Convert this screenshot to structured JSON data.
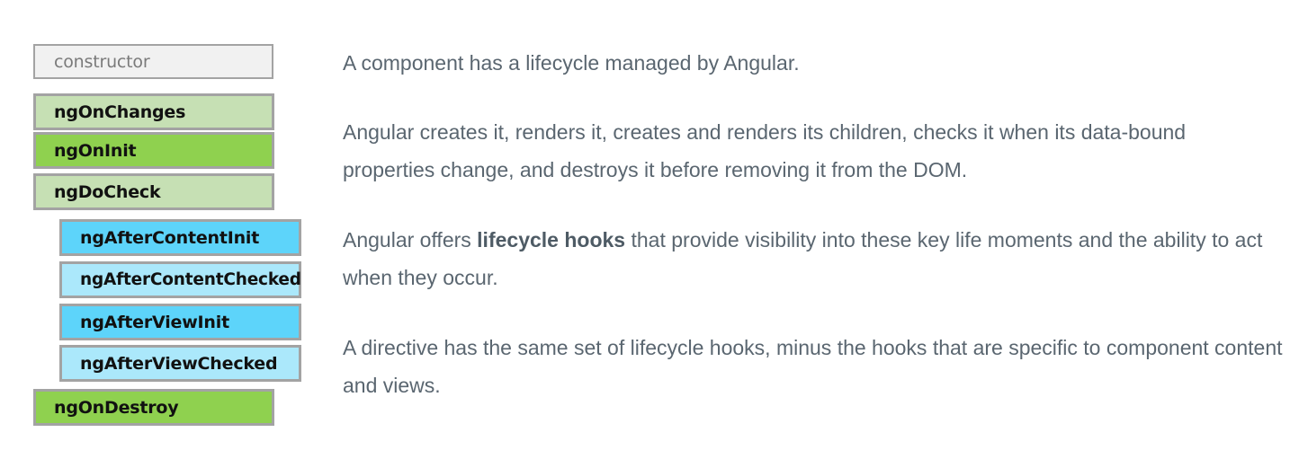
{
  "diagram": {
    "constructor": "constructor",
    "hooks": [
      "ngOnChanges",
      "ngOnInit",
      "ngDoCheck",
      "ngAfterContentInit",
      "ngAfterContentChecked",
      "ngAfterViewInit",
      "ngAfterViewChecked",
      "ngOnDestroy"
    ],
    "colors": {
      "constructor_bg": "#f1f1f1",
      "light_green": "#c6e0b4",
      "green": "#8fd14f",
      "blue": "#5dd4fa",
      "light_blue": "#abe8fb",
      "border": "#a3a3a3"
    }
  },
  "content": {
    "paragraph1": "A component has a lifecycle managed by Angular.",
    "paragraph2": "Angular creates it, renders it, creates and renders its children, checks it when its data-bound properties change, and destroys it before removing it from the DOM.",
    "paragraph3": {
      "before": "Angular offers ",
      "bold": "lifecycle hooks",
      "after": " that provide visibility into these key life moments and the ability to act when they occur."
    },
    "paragraph4": "A directive has the same set of lifecycle hooks, minus the hooks that are specific to component content and views.",
    "text_color": "#5a6670"
  }
}
